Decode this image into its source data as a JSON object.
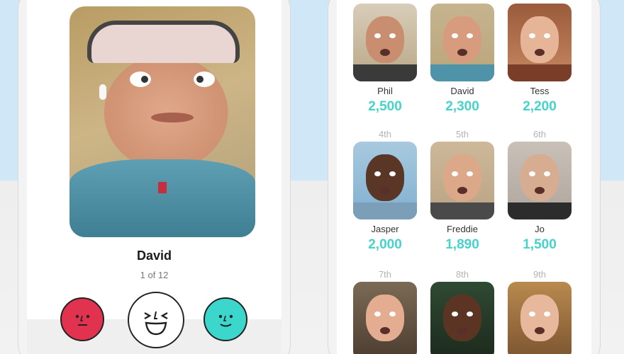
{
  "play_screen": {
    "player_name": "David",
    "player_position": "1 of 12",
    "reactions": [
      {
        "name": "unimpressed",
        "color": "#e1334f",
        "icon": "neutral-face-icon"
      },
      {
        "name": "laughing",
        "color": "#ffffff",
        "icon": "laughing-face-icon"
      },
      {
        "name": "smile",
        "color": "#3cd7cc",
        "icon": "slight-smile-face-icon"
      }
    ]
  },
  "leaderboard": {
    "accent_color": "#46d3c9",
    "entries": [
      {
        "rank": "",
        "name": "Phil",
        "score": "2,500"
      },
      {
        "rank": "",
        "name": "David",
        "score": "2,300"
      },
      {
        "rank": "",
        "name": "Tess",
        "score": "2,200"
      },
      {
        "rank": "4th",
        "name": "Jasper",
        "score": "2,000"
      },
      {
        "rank": "5th",
        "name": "Freddie",
        "score": "1,890"
      },
      {
        "rank": "6th",
        "name": "Jo",
        "score": "1,500"
      },
      {
        "rank": "7th",
        "name": "",
        "score": ""
      },
      {
        "rank": "8th",
        "name": "",
        "score": ""
      },
      {
        "rank": "9th",
        "name": "",
        "score": ""
      }
    ]
  }
}
